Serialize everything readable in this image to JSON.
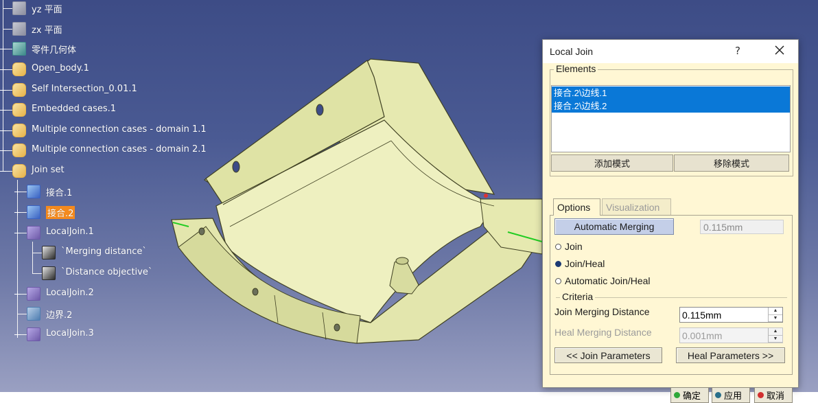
{
  "tree": {
    "items": [
      {
        "label": "yz 平面",
        "icon": "plane-icon"
      },
      {
        "label": "zx 平面",
        "icon": "plane-icon"
      },
      {
        "label": "零件几何体",
        "icon": "part-body-icon"
      },
      {
        "label": "Open_body.1",
        "icon": "geometrical-set-icon"
      },
      {
        "label": "Self Intersection_0.01.1",
        "icon": "geometrical-set-icon"
      },
      {
        "label": "Embedded cases.1",
        "icon": "geometrical-set-icon"
      },
      {
        "label": "Multiple connection cases - domain 1.1",
        "icon": "geometrical-set-icon"
      },
      {
        "label": "Multiple connection cases - domain 2.1",
        "icon": "geometrical-set-icon"
      },
      {
        "label": "Join set",
        "icon": "geometrical-set-icon"
      },
      {
        "label": "接合.1",
        "icon": "join-icon"
      },
      {
        "label": "接合.2",
        "icon": "join-icon",
        "selected": true
      },
      {
        "label": "LocalJoin.1",
        "icon": "local-join-icon"
      },
      {
        "label": "`Merging distance`",
        "icon": "parameter-icon"
      },
      {
        "label": "`Distance objective`",
        "icon": "parameter-icon"
      },
      {
        "label": "LocalJoin.2",
        "icon": "local-join-icon"
      },
      {
        "label": "边界.2",
        "icon": "boundary-icon"
      },
      {
        "label": "LocalJoin.3",
        "icon": "local-join-icon"
      }
    ]
  },
  "dialog": {
    "title": "Local Join",
    "help": "?",
    "elements_label": "Elements",
    "elements": [
      "接合.2\\边线.1",
      "接合.2\\边线.2"
    ],
    "add_mode": "添加模式",
    "remove_mode": "移除模式",
    "tabs": [
      "Options",
      "Visualization"
    ],
    "auto_merging_label": "Automatic Merging",
    "auto_merging_value": "0.115mm",
    "radios": [
      {
        "label": "Join",
        "checked": false
      },
      {
        "label": "Join/Heal",
        "checked": true
      },
      {
        "label": "Automatic Join/Heal",
        "checked": false
      }
    ],
    "criteria_label": "Criteria",
    "join_merging_label": "Join Merging Distance",
    "join_merging_value": "0.115mm",
    "heal_merging_label": "Heal Merging Distance",
    "heal_merging_value": "0.001mm",
    "join_params": "<< Join Parameters",
    "heal_params": "Heal Parameters >>",
    "ok": "确定",
    "apply": "应用",
    "cancel": "取消"
  },
  "colors": {
    "background_top": "#3d4c86",
    "dialog_body": "#fff7d4",
    "selection": "#0a78d7",
    "tree_highlight": "#f48a1e",
    "model": "#e9ecb6"
  }
}
